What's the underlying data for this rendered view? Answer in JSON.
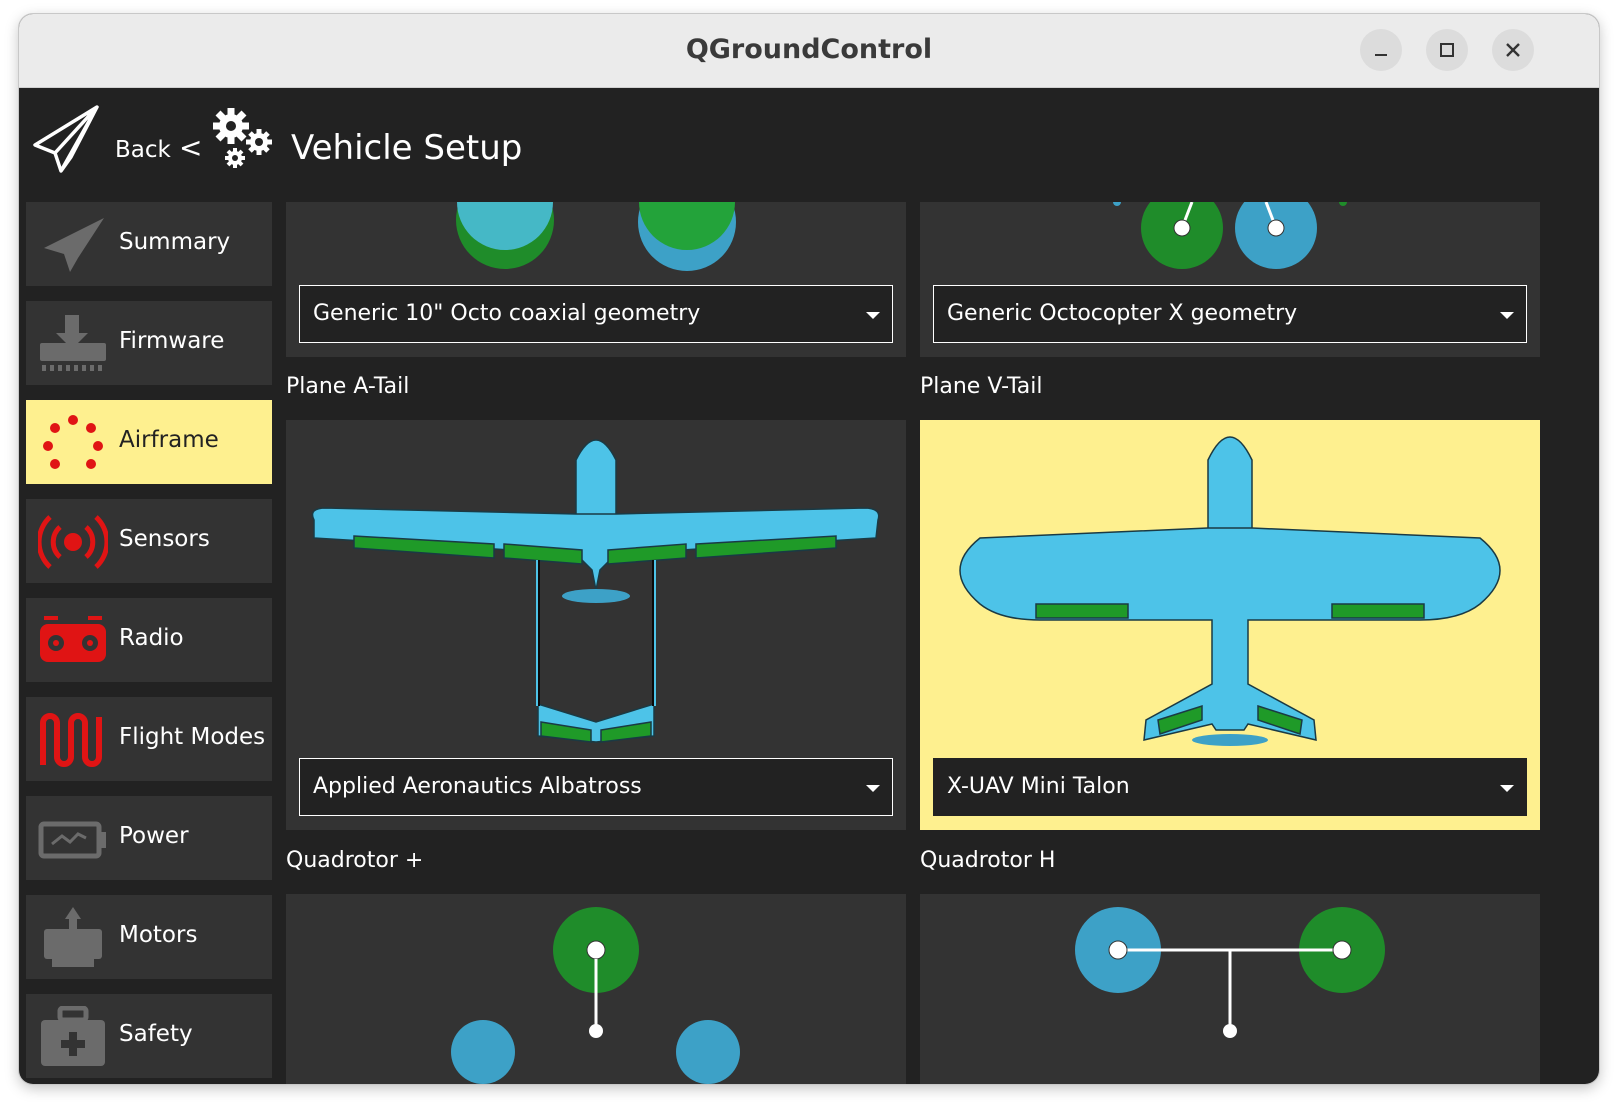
{
  "window": {
    "title": "QGroundControl"
  },
  "header": {
    "back_label": "Back",
    "separator": "<",
    "title": "Vehicle Setup"
  },
  "sidebar": {
    "items": [
      {
        "label": "Summary",
        "icon": "paper-plane-icon"
      },
      {
        "label": "Firmware",
        "icon": "download-icon"
      },
      {
        "label": "Airframe",
        "icon": "airframe-dots-icon",
        "selected": true
      },
      {
        "label": "Sensors",
        "icon": "radio-waves-icon"
      },
      {
        "label": "Radio",
        "icon": "radio-transmitter-icon"
      },
      {
        "label": "Flight Modes",
        "icon": "wave-icon"
      },
      {
        "label": "Power",
        "icon": "battery-icon"
      },
      {
        "label": "Motors",
        "icon": "motor-icon"
      },
      {
        "label": "Safety",
        "icon": "first-aid-icon"
      }
    ]
  },
  "airframes": {
    "octo_coaxial": {
      "selected_option": "Generic 10\" Octo coaxial geometry"
    },
    "octo_x": {
      "selected_option": "Generic Octocopter X geometry"
    },
    "plane_a_tail": {
      "label": "Plane A-Tail",
      "selected_option": "Applied Aeronautics Albatross"
    },
    "plane_v_tail": {
      "label": "Plane V-Tail",
      "selected_option": "X-UAV Mini Talon",
      "selected": true
    },
    "quad_plus": {
      "label": "Quadrotor +"
    },
    "quad_h": {
      "label": "Quadrotor H"
    }
  },
  "colors": {
    "selected_bg": "#fef08f",
    "tile_bg": "#333333",
    "page_bg": "#222222",
    "motor_green": "#1f8c2a",
    "motor_blue": "#3da1c7",
    "plane_blue": "#4dc3e8",
    "alert_red": "#e01414"
  }
}
